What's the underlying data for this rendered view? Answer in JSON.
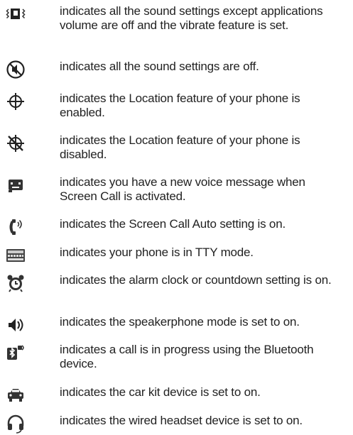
{
  "rows": [
    {
      "icon": "vibrate-only-icon",
      "text": "indicates all the sound settings except applications volume are off and the vibrate feature is set."
    },
    {
      "icon": "sound-off-icon",
      "text": "indicates all the sound settings are off."
    },
    {
      "icon": "location-on-icon",
      "text": "indicates the Location feature of your phone is enabled."
    },
    {
      "icon": "location-off-icon",
      "text": "indicates the Location feature of your phone is disabled."
    },
    {
      "icon": "voice-message-icon",
      "text": "indicates you have a new voice message when Screen Call is activated."
    },
    {
      "icon": "screen-call-auto-icon",
      "text": "indicates the Screen Call Auto setting is on."
    },
    {
      "icon": "tty-keyboard-icon",
      "text": "indicates your phone is in TTY mode."
    },
    {
      "icon": "alarm-clock-icon",
      "text": "indicates the alarm clock or countdown setting is on."
    },
    {
      "icon": "speakerphone-icon",
      "text": "indicates the speakerphone mode is set to on."
    },
    {
      "icon": "bluetooth-call-icon",
      "text": "indicates a call is in progress using the Bluetooth device."
    },
    {
      "icon": "car-kit-icon",
      "text": "indicates the car kit device is set to on."
    },
    {
      "icon": "headset-icon",
      "text": "indicates the wired headset device is set to on."
    }
  ]
}
